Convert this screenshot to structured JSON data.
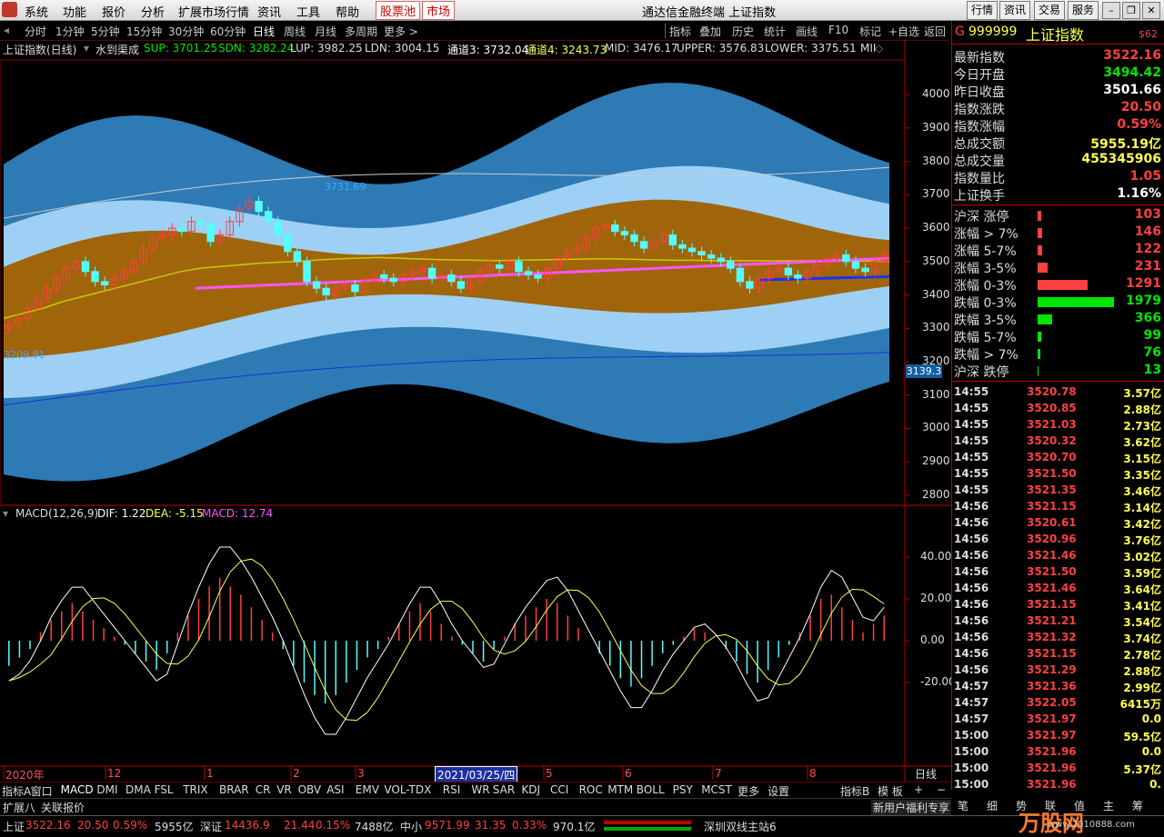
{
  "colors": {
    "up": "#ff4040",
    "down": "#54fcfc",
    "yellow": "#ffff54",
    "white": "#ffffff",
    "label": "#dddddd",
    "magenta": "#ff54ff",
    "green": "#00e600",
    "grid": "#8b0000"
  },
  "menubar": {
    "items": [
      "系统",
      "功能",
      "报价",
      "分析",
      "扩展市场行情",
      "资讯",
      "工具",
      "帮助"
    ],
    "special": [
      "股票池",
      "市场"
    ],
    "title": "通达信金融终端 上证指数",
    "right": [
      "行情",
      "资讯",
      "交易",
      "服务"
    ]
  },
  "periods": [
    "分时",
    "1分钟",
    "5分钟",
    "15分钟",
    "30分钟",
    "60分钟",
    "日线",
    "周线",
    "月线",
    "多周期",
    "更多 >"
  ],
  "active_period": "日线",
  "tools": [
    "指标",
    "叠加",
    "历史",
    "统计",
    "画线",
    "F10",
    "标记",
    "+自选",
    "返回"
  ],
  "main_info": {
    "name": "上证指数(日线)",
    "indicator": "水到渠成",
    "sup": "SUP: 3701.25",
    "sdn": "SDN: 3282.24",
    "lup": "LUP: 3982.25",
    "ldn": "LDN: 3004.15",
    "ch3": "通道3: 3732.04",
    "ch4": "通道4: 3243.73",
    "mid": "MID: 3476.17",
    "upper": "UPPER: 3576.83",
    "lower": "LOWER: 3375.51",
    "more": "MII"
  },
  "price_axis": [
    "4000",
    "3900",
    "3800",
    "3700",
    "3600",
    "3500",
    "3400",
    "3300",
    "3200",
    "3100",
    "3000",
    "2900",
    "2800"
  ],
  "price_marker": "3139.3",
  "hi_label": "3731.69",
  "lo_label": "3209.91",
  "macd_info": {
    "name": "MACD(12,26,9)",
    "dif": "DIF: 1.22",
    "dea": "DEA: -5.15",
    "macd": "MACD: 12.74"
  },
  "macd_axis": [
    "40.00",
    "20.00",
    "0.00",
    "-20.00"
  ],
  "time_axis": [
    "2020年",
    "12",
    "1",
    "2",
    "3",
    "4",
    "5",
    "6",
    "7",
    "8"
  ],
  "cursor_date": "2021/03/25/四",
  "period_label": "日线",
  "indicators": [
    "指标A",
    "窗口",
    "MACD",
    "DMI",
    "DMA",
    "FSL",
    "TRIX",
    "BRAR",
    "CR",
    "VR",
    "OBV",
    "ASI",
    "EMV",
    "VOL-TDX",
    "RSI",
    "WR",
    "SAR",
    "KDJ",
    "CCI",
    "ROC",
    "MTM",
    "BOLL",
    "PSY",
    "MCST",
    "更多",
    "设置"
  ],
  "active_indicator": "MACD",
  "ind_right": [
    "指标B",
    "模 板",
    "+",
    "−"
  ],
  "ext_tabs": [
    "扩展八",
    "关联报价"
  ],
  "promo": "新用户福利专享",
  "quote": {
    "code": "999999",
    "name": "上证指数",
    "tag": "$62",
    "rows": [
      {
        "label": "最新指数",
        "value": "3522.16",
        "color": "#ff4040"
      },
      {
        "label": "今日开盘",
        "value": "3494.42",
        "color": "#00e600"
      },
      {
        "label": "昨日收盘",
        "value": "3501.66",
        "color": "#ffffff"
      },
      {
        "label": "指数涨跌",
        "value": "20.50",
        "color": "#ff4040"
      },
      {
        "label": "指数涨幅",
        "value": "0.59%",
        "color": "#ff4040"
      },
      {
        "label": "总成交额",
        "value": "5955.19亿",
        "color": "#ffff54"
      },
      {
        "label": "总成交量",
        "value": "455345906",
        "color": "#ffff54"
      },
      {
        "label": "指数量比",
        "value": "1.05",
        "color": "#ff4040"
      },
      {
        "label": "上证换手",
        "value": "1.16%",
        "color": "#ffffff"
      }
    ],
    "dist": [
      {
        "label": "沪深 涨停",
        "value": "103",
        "color": "#ff4040",
        "bar": 4
      },
      {
        "label": "涨幅 > 7%",
        "value": "146",
        "color": "#ff4040",
        "bar": 5
      },
      {
        "label": "涨幅 5-7%",
        "value": "122",
        "color": "#ff4040",
        "bar": 5
      },
      {
        "label": "涨幅 3-5%",
        "value": "231",
        "color": "#ff4040",
        "bar": 11
      },
      {
        "label": "涨幅 0-3%",
        "value": "1291",
        "color": "#ff4040",
        "bar": 55
      },
      {
        "label": "跌幅 0-3%",
        "value": "1979",
        "color": "#00e600",
        "bar": 84
      },
      {
        "label": "跌幅 3-5%",
        "value": "366",
        "color": "#00e600",
        "bar": 16
      },
      {
        "label": "跌幅 5-7%",
        "value": "99",
        "color": "#00e600",
        "bar": 4
      },
      {
        "label": "跌幅 > 7%",
        "value": "76",
        "color": "#00e600",
        "bar": 3
      },
      {
        "label": "沪深 跌停",
        "value": "13",
        "color": "#00e600",
        "bar": 1
      }
    ],
    "ticks": [
      [
        "14:55",
        "3520.78",
        "3.57亿"
      ],
      [
        "14:55",
        "3520.85",
        "2.88亿"
      ],
      [
        "14:55",
        "3521.03",
        "2.73亿"
      ],
      [
        "14:55",
        "3520.32",
        "3.62亿"
      ],
      [
        "14:55",
        "3520.70",
        "3.15亿"
      ],
      [
        "14:55",
        "3521.50",
        "3.35亿"
      ],
      [
        "14:55",
        "3521.35",
        "3.46亿"
      ],
      [
        "14:56",
        "3521.15",
        "3.14亿"
      ],
      [
        "14:56",
        "3520.61",
        "3.42亿"
      ],
      [
        "14:56",
        "3520.96",
        "3.76亿"
      ],
      [
        "14:56",
        "3521.46",
        "3.02亿"
      ],
      [
        "14:56",
        "3521.50",
        "3.59亿"
      ],
      [
        "14:56",
        "3521.46",
        "3.64亿"
      ],
      [
        "14:56",
        "3521.15",
        "3.41亿"
      ],
      [
        "14:56",
        "3521.21",
        "3.54亿"
      ],
      [
        "14:56",
        "3521.32",
        "3.74亿"
      ],
      [
        "14:56",
        "3521.15",
        "2.78亿"
      ],
      [
        "14:56",
        "3521.29",
        "2.88亿"
      ],
      [
        "14:57",
        "3521.36",
        "2.99亿"
      ],
      [
        "14:57",
        "3522.05",
        "6415万"
      ],
      [
        "14:57",
        "3521.97",
        "0.0"
      ],
      [
        "15:00",
        "3521.97",
        "59.5亿"
      ],
      [
        "15:00",
        "3521.96",
        "0.0"
      ],
      [
        "15:00",
        "3521.96",
        "5.37亿"
      ],
      [
        "15:00",
        "3521.96",
        "0."
      ]
    ],
    "tabs": [
      "笔",
      "细",
      "势",
      "联",
      "值",
      "主",
      "筹"
    ]
  },
  "status": {
    "sh_name": "上证",
    "sh_val": "3522.16",
    "sh_chg": "20.50",
    "sh_pct": "0.59%",
    "sh_amt": "5955亿",
    "sz_name": "深证",
    "sz_val": "14436.9",
    "sz_chg": "21.44",
    "sz_pct": "0.15%",
    "sz_amt": "7488亿",
    "zx_name": "中小",
    "zx_val": "9571.99",
    "zx_chg": "31.35",
    "zx_pct": "0.33%",
    "zx_amt": "970.1亿",
    "server": "深圳双线主站6",
    "watermark": "万股网",
    "watermark_url": "www.2010888.com"
  },
  "chart_data": {
    "type": "candlestick",
    "title": "上证指数(日线)",
    "ylim": [
      2770,
      4120
    ],
    "approx_closes": [
      3310,
      3330,
      3360,
      3390,
      3420,
      3450,
      3480,
      3500,
      3470,
      3440,
      3430,
      3450,
      3470,
      3500,
      3540,
      3570,
      3580,
      3600,
      3590,
      3620,
      3610,
      3560,
      3580,
      3620,
      3660,
      3680,
      3650,
      3620,
      3580,
      3530,
      3500,
      3440,
      3420,
      3400,
      3420,
      3430,
      3410,
      3440,
      3460,
      3450,
      3440,
      3460,
      3470,
      3480,
      3450,
      3460,
      3440,
      3420,
      3440,
      3470,
      3490,
      3480,
      3500,
      3470,
      3460,
      3450,
      3480,
      3510,
      3530,
      3540,
      3570,
      3600,
      3610,
      3590,
      3580,
      3560,
      3540,
      3560,
      3580,
      3550,
      3540,
      3530,
      3520,
      3510,
      3500,
      3480,
      3440,
      3420,
      3450,
      3470,
      3480,
      3460,
      3450,
      3470,
      3490,
      3510,
      3520,
      3500,
      3480,
      3470,
      3500,
      3520
    ],
    "ma_yellow": [
      3330,
      3345,
      3360,
      3380,
      3395,
      3410,
      3425,
      3440,
      3455,
      3470,
      3480,
      3485,
      3490,
      3495,
      3498,
      3500,
      3505,
      3508,
      3510,
      3512,
      3510,
      3508,
      3506,
      3505,
      3504,
      3503,
      3504,
      3505,
      3506,
      3507,
      3508,
      3508,
      3507,
      3505,
      3504,
      3504,
      3503,
      3503,
      3502,
      3502,
      3502,
      3502,
      3502,
      3502,
      3501,
      3500
    ],
    "macd_hist": [
      -12,
      -8,
      -4,
      4,
      10,
      14,
      18,
      14,
      10,
      6,
      2,
      -2,
      -6,
      -10,
      -14,
      -6,
      4,
      12,
      20,
      26,
      30,
      26,
      22,
      16,
      10,
      4,
      -4,
      -12,
      -20,
      -26,
      -30,
      -26,
      -20,
      -14,
      -8,
      -4,
      2,
      8,
      14,
      18,
      14,
      8,
      2,
      -2,
      -6,
      -10,
      -4,
      2,
      8,
      12,
      16,
      20,
      18,
      12,
      6,
      0,
      -6,
      -12,
      -18,
      -22,
      -18,
      -12,
      -6,
      -2,
      2,
      6,
      4,
      0,
      -4,
      -10,
      -16,
      -20,
      -14,
      -8,
      -2,
      4,
      12,
      20,
      22,
      16,
      10,
      4,
      8,
      12
    ]
  }
}
